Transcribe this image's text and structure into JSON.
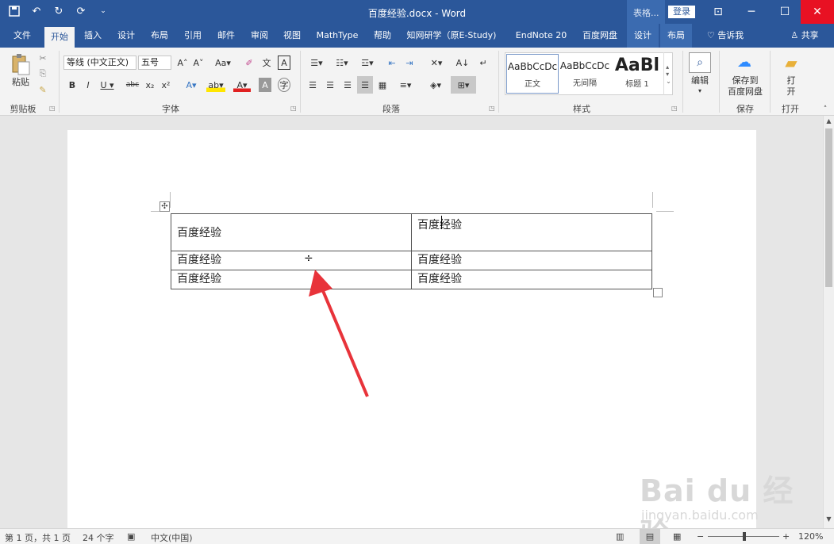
{
  "titlebar": {
    "doc_title": "百度经验.docx - Word",
    "context_tab": "表格...",
    "login": "登录"
  },
  "tabs": [
    "文件",
    "开始",
    "插入",
    "设计",
    "布局",
    "引用",
    "邮件",
    "审阅",
    "视图",
    "MathType",
    "帮助",
    "知网研学（原E-Study)",
    "EndNote 20",
    "百度网盘",
    "设计",
    "布局"
  ],
  "tell_me": "告诉我",
  "share": "共享",
  "ribbon": {
    "clipboard": {
      "paste": "粘贴",
      "label": "剪贴板"
    },
    "font": {
      "font_name": "等线 (中文正文)",
      "font_size": "五号",
      "label": "字体"
    },
    "paragraph": {
      "label": "段落"
    },
    "styles": {
      "label": "样式",
      "items": [
        {
          "sample": "AaBbCcDc",
          "name": "正文"
        },
        {
          "sample": "AaBbCcDc",
          "name": "无间隔"
        },
        {
          "sample": "AaBl",
          "name": "标题 1"
        }
      ]
    },
    "editing": {
      "label": "编辑"
    },
    "save": {
      "line1": "保存到",
      "line2": "百度网盘",
      "label": "保存"
    },
    "open": {
      "line1": "打",
      "line2": "开",
      "label": "打开"
    }
  },
  "table": {
    "rows": [
      [
        "百度经验",
        "百度经验"
      ],
      [
        "百度经验",
        "百度经验"
      ],
      [
        "百度经验",
        "百度经验"
      ]
    ]
  },
  "cursor_glyph": "÷",
  "status": {
    "page": "第 1 页，共 1 页",
    "words": "24 个字",
    "language": "中文(中国)",
    "zoom": "120%"
  },
  "watermark": {
    "line1": "Bai du 经验",
    "line2": "jingyan.baidu.com"
  },
  "colors": {
    "accent": "#2b579a",
    "arrow": "#e8333a"
  }
}
